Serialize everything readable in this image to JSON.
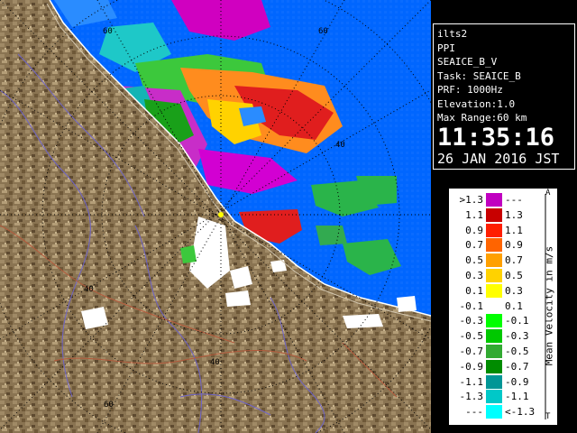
{
  "info": {
    "site": "ilts2",
    "product": "PPI",
    "field": "SEAICE_B_V",
    "task": "Task: SEAICE_B",
    "prf": "PRF: 1000Hz",
    "elevation": "Elevation:1.0",
    "max_range": "Max Range:60 km",
    "time": "11:35:16",
    "date": "26 JAN 2016 JST"
  },
  "map": {
    "range_ring_labels": [
      "60",
      "60",
      "40",
      "40",
      "40",
      "60"
    ]
  },
  "legend": {
    "axis_label": "Mean Velocity in m/s",
    "top_mark": "A",
    "bottom_mark": "T",
    "rows": [
      {
        "lo": ">1.3",
        "hi": "---",
        "color": "#c000c0"
      },
      {
        "lo": "1.1",
        "hi": "1.3",
        "color": "#c80000"
      },
      {
        "lo": "0.9",
        "hi": "1.1",
        "color": "#ff1e00"
      },
      {
        "lo": "0.7",
        "hi": "0.9",
        "color": "#ff6400"
      },
      {
        "lo": "0.5",
        "hi": "0.7",
        "color": "#ffa000"
      },
      {
        "lo": "0.3",
        "hi": "0.5",
        "color": "#ffd200"
      },
      {
        "lo": "0.1",
        "hi": "0.3",
        "color": "#ffff00"
      },
      {
        "lo": "-0.1",
        "hi": "0.1",
        "color": "#ffffff"
      },
      {
        "lo": "-0.3",
        "hi": "-0.1",
        "color": "#00ff00"
      },
      {
        "lo": "-0.5",
        "hi": "-0.3",
        "color": "#00c800"
      },
      {
        "lo": "-0.7",
        "hi": "-0.5",
        "color": "#32aa32"
      },
      {
        "lo": "-0.9",
        "hi": "-0.7",
        "color": "#008c00"
      },
      {
        "lo": "-1.1",
        "hi": "-0.9",
        "color": "#009696"
      },
      {
        "lo": "-1.3",
        "hi": "-1.1",
        "color": "#00c8c8"
      },
      {
        "lo": "---",
        "hi": "<-1.3",
        "color": "#00ffff"
      }
    ]
  }
}
